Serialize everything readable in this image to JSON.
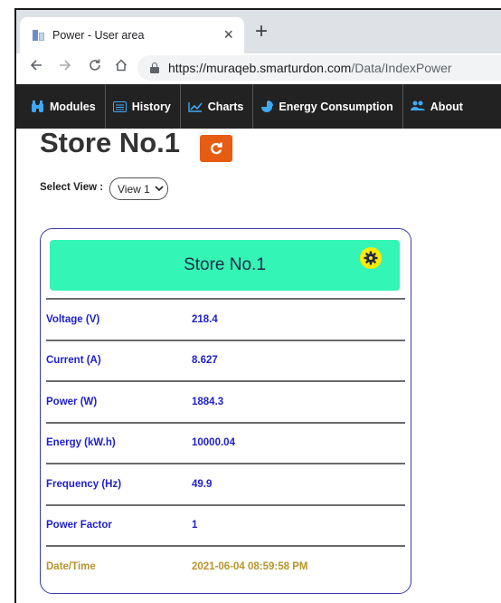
{
  "browser": {
    "tab_title": "Power - User area",
    "close_glyph": "×",
    "new_tab_glyph": "+",
    "url_host": "https://muraqeb.smarturdon.com",
    "url_path": "/Data/IndexPower"
  },
  "navbar": {
    "items": [
      {
        "label": "Modules",
        "icon": "binoculars-icon"
      },
      {
        "label": "History",
        "icon": "list-icon"
      },
      {
        "label": "Charts",
        "icon": "line-chart-icon"
      },
      {
        "label": "Energy Consumption",
        "icon": "pie-chart-icon"
      },
      {
        "label": "About",
        "icon": "users-icon"
      }
    ]
  },
  "page": {
    "title": "Store No.1",
    "select_label": "Select View :",
    "select_value": "View 1"
  },
  "card": {
    "title": "Store No.1",
    "rows": [
      {
        "label": "Voltage (V)",
        "value": "218.4"
      },
      {
        "label": "Current (A)",
        "value": "8.627"
      },
      {
        "label": "Power (W)",
        "value": "1884.3"
      },
      {
        "label": "Energy (kW.h)",
        "value": "10000.04"
      },
      {
        "label": "Frequency (Hz)",
        "value": "49.9"
      },
      {
        "label": "Power Factor",
        "value": "1"
      },
      {
        "label": "Date/Time",
        "value": "2021-06-04 08:59:58 PM"
      }
    ]
  },
  "colors": {
    "navbar_bg": "#222222",
    "refresh_button": "#e55c12",
    "card_header": "#33f5b6",
    "gear_button": "#ffea00",
    "value_text": "#1f1fcc",
    "datetime_text": "#b8942b",
    "card_border": "#3a3aa8"
  }
}
